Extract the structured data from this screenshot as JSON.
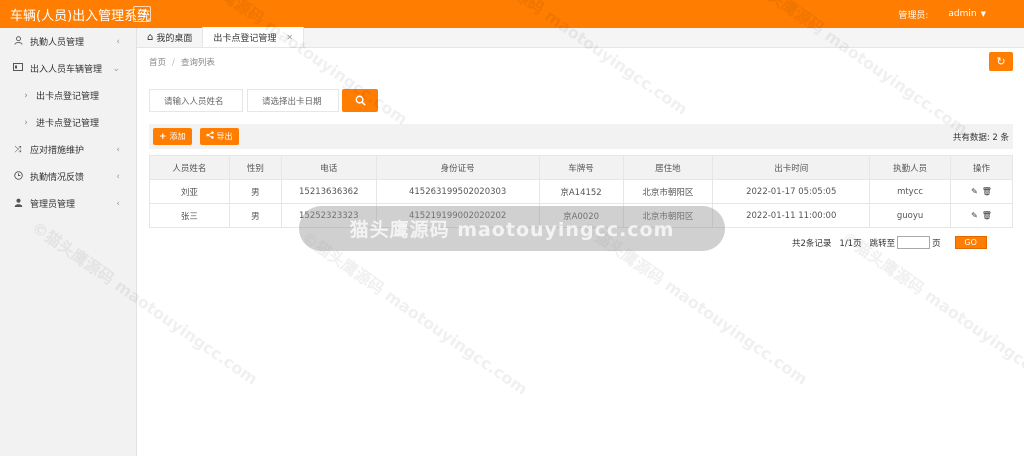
{
  "app": {
    "title": "车辆(人员)出入管理系统"
  },
  "topbar": {
    "admin_label": "管理员:",
    "admin_user": "admin"
  },
  "sidebar": {
    "items": [
      {
        "label": "执勤人员管理"
      },
      {
        "label": "出入人员车辆管理"
      },
      {
        "label": "出卡点登记管理"
      },
      {
        "label": "进卡点登记管理"
      },
      {
        "label": "应对措施维护"
      },
      {
        "label": "执勤情况反馈"
      },
      {
        "label": "管理员管理"
      }
    ]
  },
  "tabs": [
    {
      "label": "我的桌面"
    },
    {
      "label": "出卡点登记管理"
    }
  ],
  "breadcrumb": {
    "home": "首页",
    "current": "查询列表"
  },
  "search": {
    "name_placeholder": "请输入人员姓名",
    "date_placeholder": "请选择出卡日期"
  },
  "toolbar": {
    "add_label": "添加",
    "export_label": "导出",
    "total_text": "共有数据: 2 条"
  },
  "table": {
    "headers": [
      "人员姓名",
      "性别",
      "电话",
      "身份证号",
      "车牌号",
      "居住地",
      "出卡时间",
      "执勤人员",
      "操作"
    ],
    "rows": [
      [
        "刘亚",
        "男",
        "15213636362",
        "415263199502020303",
        "京A14152",
        "北京市朝阳区",
        "2022-01-17 05:05:05",
        "mtycc"
      ],
      [
        "张三",
        "男",
        "15252323323",
        "415219199002020202",
        "京A0020",
        "北京市朝阳区",
        "2022-01-11 11:00:00",
        "guoyu"
      ]
    ]
  },
  "pager": {
    "records": "共2条记录",
    "pages": "1/1页",
    "jump_to": "跳转至",
    "page_unit": "页",
    "go": "GO"
  },
  "watermark": {
    "overlay": "猫头鹰源码 maotouyingcc.com",
    "diag": "©猫头鹰源码 maotouyingcc.com"
  },
  "colors": {
    "accent": "#ff7d00"
  }
}
